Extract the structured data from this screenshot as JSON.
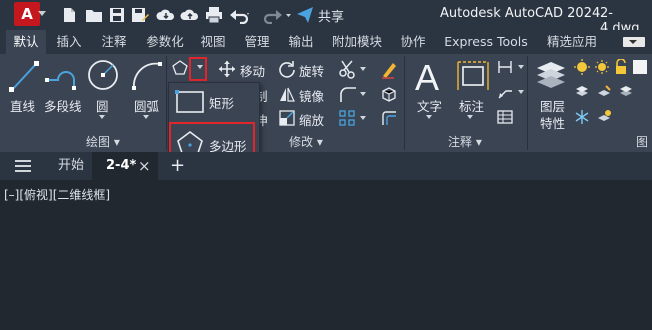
{
  "titlebar": {
    "logo_letter": "A",
    "share_label": "共享",
    "app_title": "Autodesk AutoCAD 2024",
    "file_name": "2-4.dwg"
  },
  "ribbon_tabs": [
    {
      "label": "默认",
      "active": true
    },
    {
      "label": "插入"
    },
    {
      "label": "注释"
    },
    {
      "label": "参数化"
    },
    {
      "label": "视图"
    },
    {
      "label": "管理"
    },
    {
      "label": "输出"
    },
    {
      "label": "附加模块"
    },
    {
      "label": "协作"
    },
    {
      "label": "Express Tools"
    },
    {
      "label": "精选应用"
    }
  ],
  "draw_panel": {
    "line": "直线",
    "polyline": "多段线",
    "circle": "圆",
    "arc": "圆弧",
    "footer": "绘图"
  },
  "flyout": {
    "rectangle": "矩形",
    "polygon": "多边形"
  },
  "modify_panel": {
    "move": "移动",
    "rotate": "旋转",
    "mirror": "镜像",
    "scale": "缩放",
    "partial_copy": "制",
    "partial_stretch": "伸",
    "footer": "修改"
  },
  "annotation_panel": {
    "text": "文字",
    "dimension": "标注",
    "footer": "注释"
  },
  "layers_panel": {
    "layer_props_line1": "图层",
    "layer_props_line2": "特性",
    "footer_partial": "图"
  },
  "doc_tabs": {
    "menu_icon": "hamburger-menu-icon",
    "start": "开始",
    "current": "2-4*",
    "close": "×",
    "add": "+"
  },
  "viewport_label": "[–][俯视][二维线框]",
  "colors": {
    "highlight": "#e0262b",
    "logo": "#c4171e",
    "accent_blue": "#4aa3df"
  }
}
